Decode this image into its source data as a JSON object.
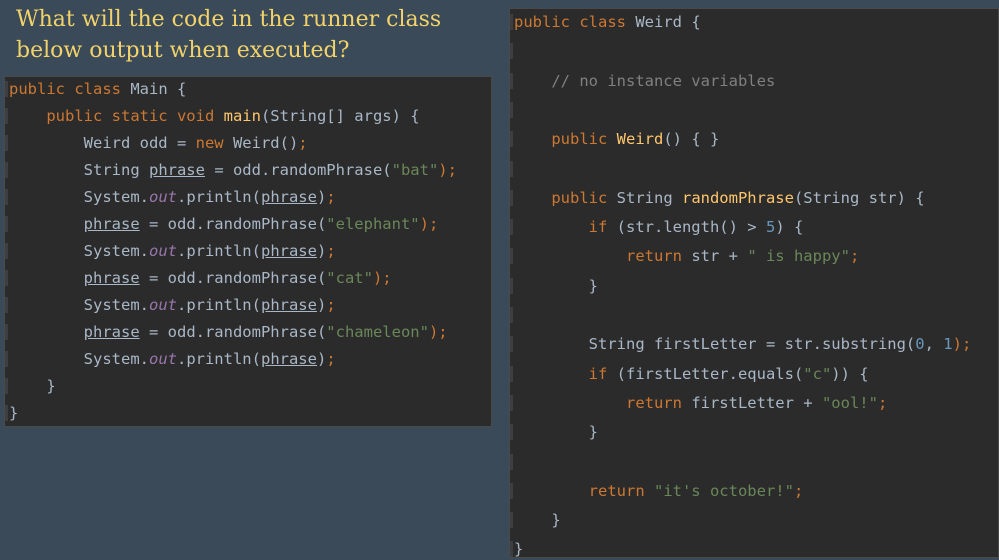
{
  "question": {
    "text": "What will the code in the runner class below output when executed?"
  },
  "main_code": {
    "lines": [
      [
        {
          "t": "public class ",
          "c": "kw"
        },
        {
          "t": "Main {",
          "c": ""
        }
      ],
      [
        {
          "t": "    public static void ",
          "c": "kw"
        },
        {
          "t": "main",
          "c": "fn"
        },
        {
          "t": "(String[] args) {",
          "c": ""
        }
      ],
      [
        {
          "t": "        Weird odd = ",
          "c": ""
        },
        {
          "t": "new ",
          "c": "kw"
        },
        {
          "t": "Weird()",
          "c": ""
        },
        {
          "t": ";",
          "c": "kw"
        }
      ],
      [
        {
          "t": "        String ",
          "c": ""
        },
        {
          "t": "phrase",
          "c": "und"
        },
        {
          "t": " = odd.randomPhrase(",
          "c": ""
        },
        {
          "t": "\"bat\"",
          "c": "str"
        },
        {
          "t": ");",
          "c": "kw"
        }
      ],
      [
        {
          "t": "        System.",
          "c": ""
        },
        {
          "t": "out",
          "c": "static"
        },
        {
          "t": ".println(",
          "c": ""
        },
        {
          "t": "phrase",
          "c": "und"
        },
        {
          "t": ")",
          "c": ""
        },
        {
          "t": ";",
          "c": "kw"
        }
      ],
      [
        {
          "t": "        ",
          "c": ""
        },
        {
          "t": "phrase",
          "c": "und"
        },
        {
          "t": " = odd.randomPhrase(",
          "c": ""
        },
        {
          "t": "\"elephant\"",
          "c": "str"
        },
        {
          "t": ");",
          "c": "kw"
        }
      ],
      [
        {
          "t": "        System.",
          "c": ""
        },
        {
          "t": "out",
          "c": "static"
        },
        {
          "t": ".println(",
          "c": ""
        },
        {
          "t": "phrase",
          "c": "und"
        },
        {
          "t": ")",
          "c": ""
        },
        {
          "t": ";",
          "c": "kw"
        }
      ],
      [
        {
          "t": "        ",
          "c": ""
        },
        {
          "t": "phrase",
          "c": "und"
        },
        {
          "t": " = odd.randomPhrase(",
          "c": ""
        },
        {
          "t": "\"cat\"",
          "c": "str"
        },
        {
          "t": ");",
          "c": "kw"
        }
      ],
      [
        {
          "t": "        System.",
          "c": ""
        },
        {
          "t": "out",
          "c": "static"
        },
        {
          "t": ".println(",
          "c": ""
        },
        {
          "t": "phrase",
          "c": "und"
        },
        {
          "t": ")",
          "c": ""
        },
        {
          "t": ";",
          "c": "kw"
        }
      ],
      [
        {
          "t": "        ",
          "c": ""
        },
        {
          "t": "phrase",
          "c": "und"
        },
        {
          "t": " = odd.randomPhrase(",
          "c": ""
        },
        {
          "t": "\"chameleon\"",
          "c": "str"
        },
        {
          "t": ");",
          "c": "kw"
        }
      ],
      [
        {
          "t": "        System.",
          "c": ""
        },
        {
          "t": "out",
          "c": "static"
        },
        {
          "t": ".println(",
          "c": ""
        },
        {
          "t": "phrase",
          "c": "und"
        },
        {
          "t": ")",
          "c": ""
        },
        {
          "t": ";",
          "c": "kw"
        }
      ],
      [
        {
          "t": "    }",
          "c": ""
        }
      ],
      [
        {
          "t": "}",
          "c": ""
        }
      ]
    ]
  },
  "weird_code": {
    "lines": [
      [
        {
          "t": "public class ",
          "c": "kw"
        },
        {
          "t": "Weird {",
          "c": ""
        }
      ],
      [],
      [
        {
          "t": "    // no instance variables",
          "c": "cmt"
        }
      ],
      [],
      [
        {
          "t": "    public ",
          "c": "kw"
        },
        {
          "t": "Weird",
          "c": "fn"
        },
        {
          "t": "() { }",
          "c": ""
        }
      ],
      [],
      [
        {
          "t": "    public ",
          "c": "kw"
        },
        {
          "t": "String ",
          "c": ""
        },
        {
          "t": "randomPhrase",
          "c": "fn"
        },
        {
          "t": "(String str) {",
          "c": ""
        }
      ],
      [
        {
          "t": "        if ",
          "c": "kw"
        },
        {
          "t": "(str.length() > ",
          "c": ""
        },
        {
          "t": "5",
          "c": "num"
        },
        {
          "t": ") {",
          "c": ""
        }
      ],
      [
        {
          "t": "            return ",
          "c": "kw"
        },
        {
          "t": "str + ",
          "c": ""
        },
        {
          "t": "\" is happy\"",
          "c": "str"
        },
        {
          "t": ";",
          "c": "kw"
        }
      ],
      [
        {
          "t": "        }",
          "c": ""
        }
      ],
      [],
      [
        {
          "t": "        String firstLetter = str.substring(",
          "c": ""
        },
        {
          "t": "0",
          "c": "num"
        },
        {
          "t": ", ",
          "c": ""
        },
        {
          "t": "1",
          "c": "num"
        },
        {
          "t": ");",
          "c": "kw"
        }
      ],
      [
        {
          "t": "        if ",
          "c": "kw"
        },
        {
          "t": "(firstLetter.equals(",
          "c": ""
        },
        {
          "t": "\"c\"",
          "c": "str"
        },
        {
          "t": ")) {",
          "c": ""
        }
      ],
      [
        {
          "t": "            return ",
          "c": "kw"
        },
        {
          "t": "firstLetter + ",
          "c": ""
        },
        {
          "t": "\"ool!\"",
          "c": "str"
        },
        {
          "t": ";",
          "c": "kw"
        }
      ],
      [
        {
          "t": "        }",
          "c": ""
        }
      ],
      [],
      [
        {
          "t": "        return ",
          "c": "kw"
        },
        {
          "t": "\"it's october!\"",
          "c": "str"
        },
        {
          "t": ";",
          "c": "kw"
        }
      ],
      [
        {
          "t": "    }",
          "c": ""
        }
      ],
      [
        {
          "t": "}",
          "c": ""
        }
      ]
    ]
  }
}
